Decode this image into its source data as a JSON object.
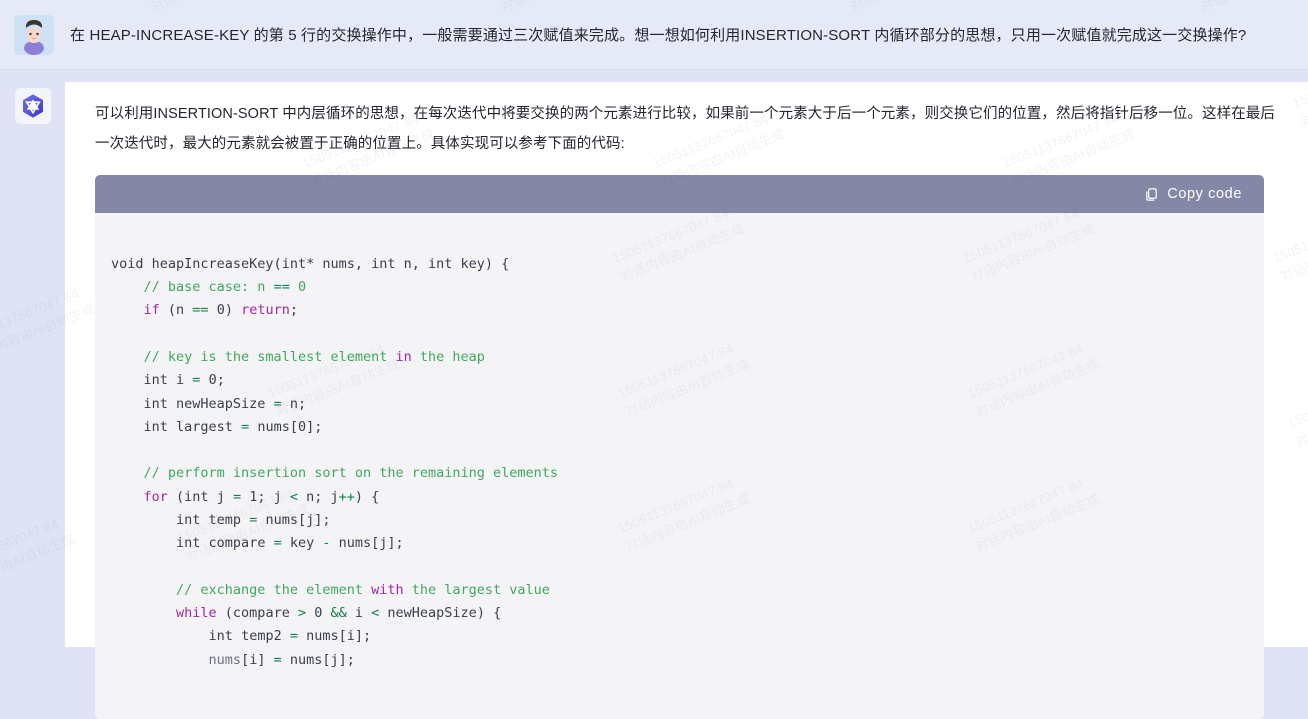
{
  "watermark": {
    "line1": "15051137667047 84",
    "line2": "对话内容由AI自动生成"
  },
  "user_message": {
    "avatar_name": "user-avatar",
    "text": "在 HEAP-INCREASE-KEY 的第 5 行的交换操作中，一般需要通过三次赋值来完成。想一想如何利用INSERTION-SORT 内循环部分的思想，只用一次赋值就完成这一交换操作?"
  },
  "assistant_message": {
    "avatar_name": "assistant-logo",
    "paragraph": "可以利用INSERTION-SORT 中内层循环的思想，在每次迭代中将要交换的两个元素进行比较，如果前一个元素大于后一个元素，则交换它们的位置，然后将指针后移一位。这样在最后一次迭代时，最大的元素就会被置于正确的位置上。具体实现可以参考下面的代码:"
  },
  "code_block": {
    "copy_label": "Copy code",
    "copy_icon": "copy-icon",
    "header_color": "#8487a6",
    "body_color": "#f4f4f7",
    "lines": [
      "void heapIncreaseKey(int* nums, int n, int key) {",
      "    // base case: n == 0",
      "    if (n == 0) return;",
      "",
      "    // key is the smallest element in the heap",
      "    int i = 0;",
      "    int newHeapSize = n;",
      "    int largest = nums[0];",
      "",
      "    // perform insertion sort on the remaining elements",
      "    for (int j = 1; j < n; j++) {",
      "        int temp = nums[j];",
      "        int compare = key - nums[j];",
      "",
      "        // exchange the element with the largest value",
      "        while (compare > 0 && i < newHeapSize) {",
      "            int temp2 = nums[i];",
      "            nums[i] = nums[j];"
    ]
  },
  "colors": {
    "page_background": "#dfe3f5",
    "user_row_background": "#e6eaf8",
    "card_background": "#ffffff",
    "comment": "#41a85f",
    "keyword": "#a626a4",
    "operator": "#11824a"
  }
}
